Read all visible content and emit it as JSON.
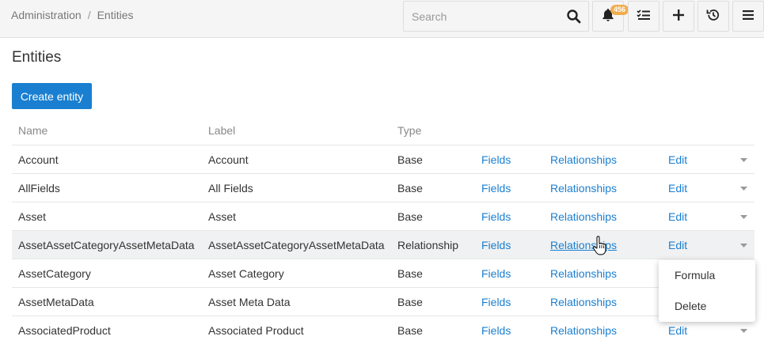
{
  "breadcrumb": {
    "parent": "Administration",
    "separator": "/",
    "current": "Entities"
  },
  "search": {
    "placeholder": "Search",
    "value": ""
  },
  "toolbar": {
    "notifications_count": "456",
    "icons": [
      "bell-icon",
      "tasks-icon",
      "plus-icon",
      "history-icon",
      "menu-icon"
    ]
  },
  "page": {
    "title": "Entities",
    "create_label": "Create entity"
  },
  "table": {
    "headers": {
      "name": "Name",
      "label": "Label",
      "type": "Type"
    },
    "link_labels": {
      "fields": "Fields",
      "relationships": "Relationships",
      "edit": "Edit"
    },
    "rows": [
      {
        "name": "Account",
        "label": "Account",
        "type": "Base"
      },
      {
        "name": "AllFields",
        "label": "All Fields",
        "type": "Base"
      },
      {
        "name": "Asset",
        "label": "Asset",
        "type": "Base"
      },
      {
        "name": "AssetAssetCategoryAssetMetaData",
        "label": "AssetAssetCategoryAssetMetaData",
        "type": "Relationship"
      },
      {
        "name": "AssetCategory",
        "label": "Asset Category",
        "type": "Base"
      },
      {
        "name": "AssetMetaData",
        "label": "Asset Meta Data",
        "type": "Base"
      },
      {
        "name": "AssociatedProduct",
        "label": "Associated Product",
        "type": "Base"
      }
    ]
  },
  "dropdown": {
    "items": [
      "Formula",
      "Delete"
    ]
  },
  "colors": {
    "accent": "#1a7fd0",
    "badge": "#f0ad4e",
    "topbar": "#f5f5f5",
    "row_hover": "#f0f1f2"
  }
}
